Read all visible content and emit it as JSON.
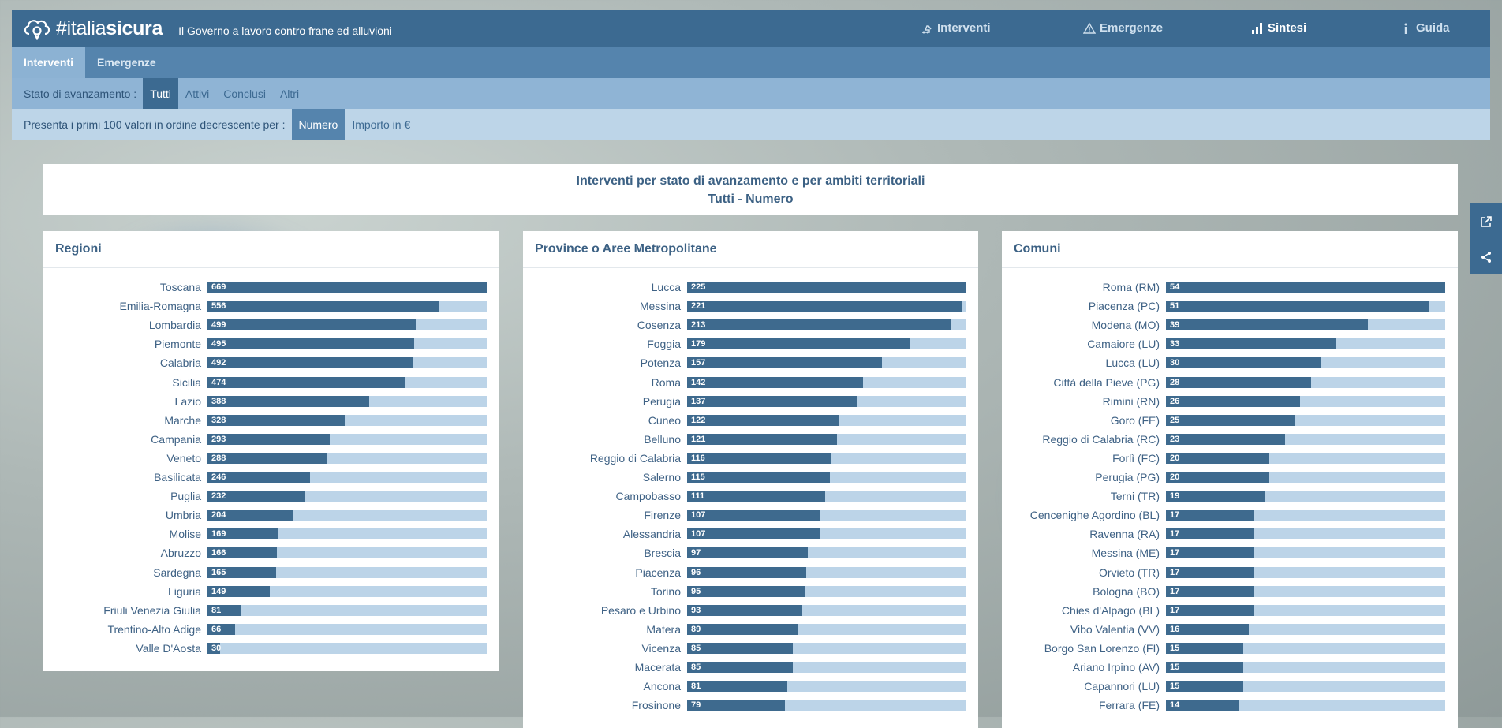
{
  "header": {
    "logo_text_prefix": "#italia",
    "logo_text_bold": "sicura",
    "tagline": "Il Governo a lavoro contro frane ed alluvioni",
    "nav": [
      {
        "label": "Interventi",
        "icon": "excavator-icon"
      },
      {
        "label": "Emergenze",
        "icon": "warning-icon"
      },
      {
        "label": "Sintesi",
        "icon": "bar-chart-icon",
        "active": true
      },
      {
        "label": "Guida",
        "icon": "info-icon"
      }
    ]
  },
  "tabs": [
    {
      "label": "Interventi",
      "active": true
    },
    {
      "label": "Emergenze",
      "active": false
    }
  ],
  "status_filter": {
    "label": "Stato di avanzamento :",
    "options": [
      {
        "label": "Tutti",
        "active": true
      },
      {
        "label": "Attivi",
        "active": false
      },
      {
        "label": "Conclusi",
        "active": false
      },
      {
        "label": "Altri",
        "active": false
      }
    ]
  },
  "sort_filter": {
    "label": "Presenta i primi 100 valori in ordine decrescente per :",
    "options": [
      {
        "label": "Numero",
        "active": true
      },
      {
        "label": "Importo in €",
        "active": false
      }
    ]
  },
  "title": {
    "line1": "Interventi per stato di avanzamento e per ambiti territoriali",
    "line2": "Tutti - Numero"
  },
  "colors": {
    "header": "#3c6a91",
    "bar_fill": "#3e6a8e",
    "bar_track": "#bcd4e8"
  },
  "chart_data": [
    {
      "type": "bar",
      "title": "Regioni",
      "categories": [
        "Toscana",
        "Emilia-Romagna",
        "Lombardia",
        "Piemonte",
        "Calabria",
        "Sicilia",
        "Lazio",
        "Marche",
        "Campania",
        "Veneto",
        "Basilicata",
        "Puglia",
        "Umbria",
        "Molise",
        "Abruzzo",
        "Sardegna",
        "Liguria",
        "Friuli Venezia Giulia",
        "Trentino-Alto Adige",
        "Valle D'Aosta"
      ],
      "values": [
        669,
        556,
        499,
        495,
        492,
        474,
        388,
        328,
        293,
        288,
        246,
        232,
        204,
        169,
        166,
        165,
        149,
        81,
        66,
        30
      ]
    },
    {
      "type": "bar",
      "title": "Province o Aree Metropolitane",
      "categories": [
        "Lucca",
        "Messina",
        "Cosenza",
        "Foggia",
        "Potenza",
        "Roma",
        "Perugia",
        "Cuneo",
        "Belluno",
        "Reggio di Calabria",
        "Salerno",
        "Campobasso",
        "Firenze",
        "Alessandria",
        "Brescia",
        "Piacenza",
        "Torino",
        "Pesaro e Urbino",
        "Matera",
        "Vicenza",
        "Macerata",
        "Ancona",
        "Frosinone"
      ],
      "values": [
        225,
        221,
        213,
        179,
        157,
        142,
        137,
        122,
        121,
        116,
        115,
        111,
        107,
        107,
        97,
        96,
        95,
        93,
        89,
        85,
        85,
        81,
        79
      ]
    },
    {
      "type": "bar",
      "title": "Comuni",
      "categories": [
        "Roma (RM)",
        "Piacenza (PC)",
        "Modena (MO)",
        "Camaiore (LU)",
        "Lucca (LU)",
        "Città della Pieve (PG)",
        "Rimini (RN)",
        "Goro (FE)",
        "Reggio di Calabria (RC)",
        "Forlì (FC)",
        "Perugia (PG)",
        "Terni (TR)",
        "Cencenighe Agordino (BL)",
        "Ravenna (RA)",
        "Messina (ME)",
        "Orvieto (TR)",
        "Bologna (BO)",
        "Chies d'Alpago (BL)",
        "Vibo Valentia (VV)",
        "Borgo San Lorenzo (FI)",
        "Ariano Irpino (AV)",
        "Capannori (LU)",
        "Ferrara (FE)"
      ],
      "values": [
        54,
        51,
        39,
        33,
        30,
        28,
        26,
        25,
        23,
        20,
        20,
        19,
        17,
        17,
        17,
        17,
        17,
        17,
        16,
        15,
        15,
        15,
        14
      ]
    }
  ]
}
